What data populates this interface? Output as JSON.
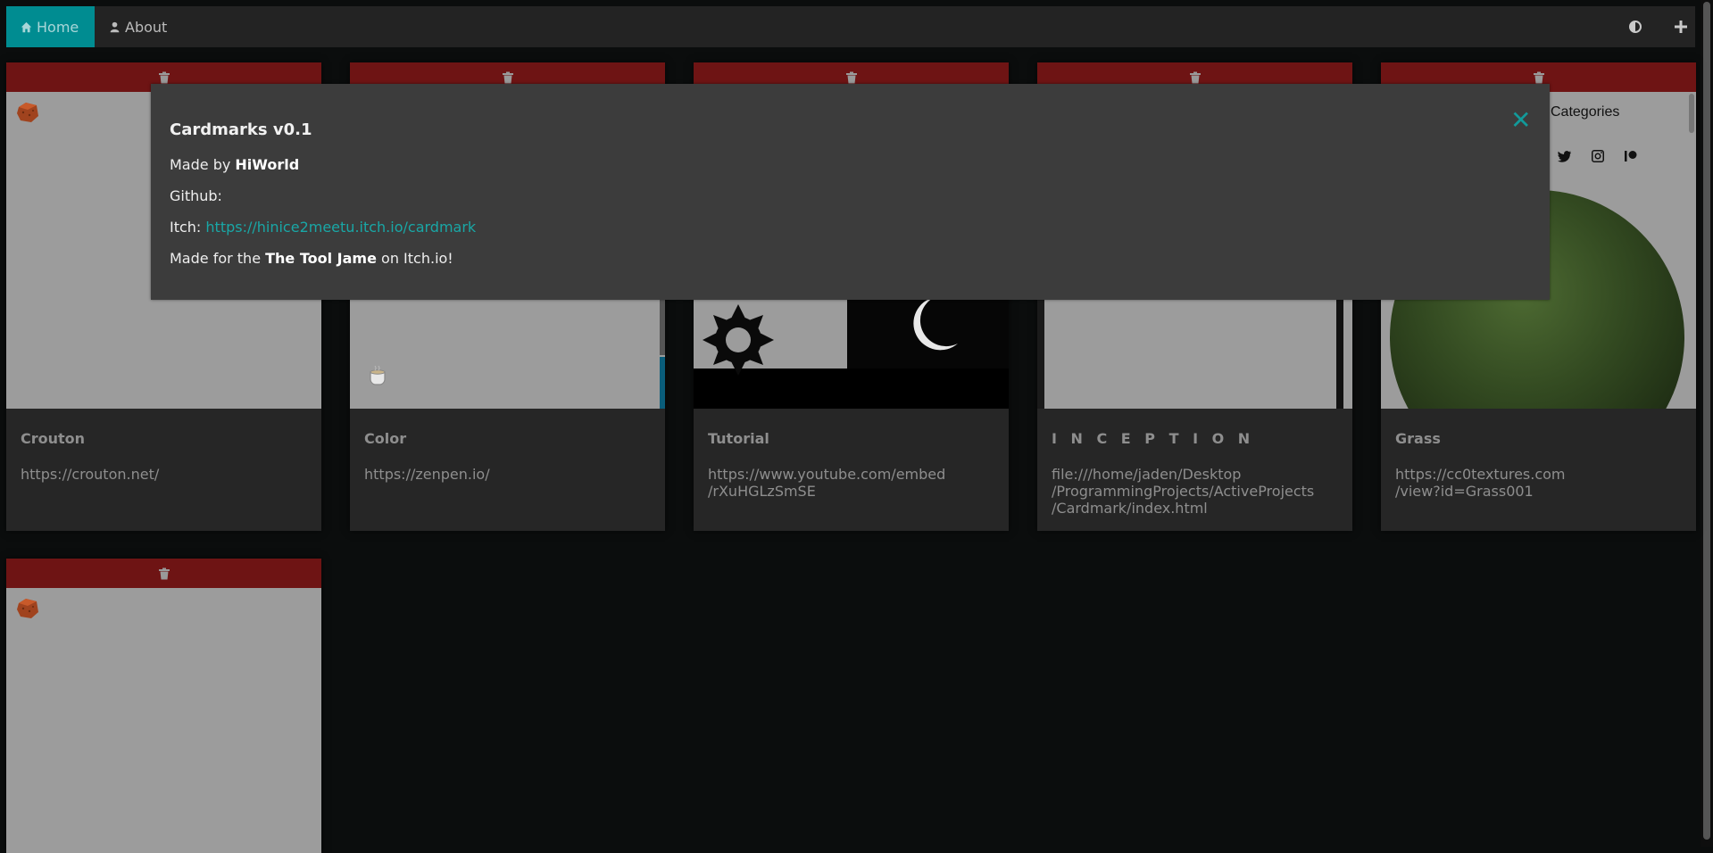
{
  "navbar": {
    "home_label": "Home",
    "about_label": "About",
    "icons": {
      "home": "home-icon",
      "about": "user-icon",
      "theme": "contrast-icon",
      "add": "plus-icon"
    }
  },
  "cards": [
    {
      "title": "Crouton",
      "url": "https://crouton.net/"
    },
    {
      "title": "Color",
      "url": "https://zenpen.io/"
    },
    {
      "title": "Tutorial",
      "url": "https://www.youtube.com/embed\n/rXuHGLzSmSE"
    },
    {
      "title": "I N C E P T I O N",
      "url": "file:///home/jaden/Desktop\n/ProgrammingProjects/ActiveProjects\n/Cardmark/index.html"
    },
    {
      "title": "Grass",
      "url": "https://cc0textures.com\n/view?id=Grass001"
    },
    {
      "title": "",
      "url": ""
    }
  ],
  "grass_preview": {
    "categories_label": "Categories"
  },
  "modal": {
    "title": "Cardmarks v0.1",
    "made_by_prefix": "Made by ",
    "made_by_name": "HiWorld",
    "github_label": "Github:",
    "itch_label": "Itch: ",
    "itch_url": "https://hinice2meetu.itch.io/cardmark",
    "made_for_prefix": "Made for the ",
    "made_for_name": "The Tool Jame",
    "made_for_suffix": " on Itch.io!",
    "close_glyph": "✕"
  },
  "colors": {
    "accent": "#008c91",
    "card_header": "#6e1414",
    "link": "#19a7a6"
  }
}
